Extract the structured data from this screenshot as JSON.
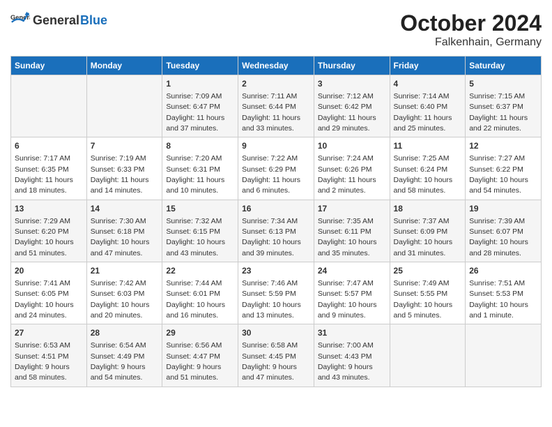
{
  "header": {
    "logo_general": "General",
    "logo_blue": "Blue",
    "month_year": "October 2024",
    "location": "Falkenhain, Germany"
  },
  "weekdays": [
    "Sunday",
    "Monday",
    "Tuesday",
    "Wednesday",
    "Thursday",
    "Friday",
    "Saturday"
  ],
  "weeks": [
    [
      {
        "day": "",
        "sunrise": "",
        "sunset": "",
        "daylight": ""
      },
      {
        "day": "",
        "sunrise": "",
        "sunset": "",
        "daylight": ""
      },
      {
        "day": "1",
        "sunrise": "Sunrise: 7:09 AM",
        "sunset": "Sunset: 6:47 PM",
        "daylight": "Daylight: 11 hours and 37 minutes."
      },
      {
        "day": "2",
        "sunrise": "Sunrise: 7:11 AM",
        "sunset": "Sunset: 6:44 PM",
        "daylight": "Daylight: 11 hours and 33 minutes."
      },
      {
        "day": "3",
        "sunrise": "Sunrise: 7:12 AM",
        "sunset": "Sunset: 6:42 PM",
        "daylight": "Daylight: 11 hours and 29 minutes."
      },
      {
        "day": "4",
        "sunrise": "Sunrise: 7:14 AM",
        "sunset": "Sunset: 6:40 PM",
        "daylight": "Daylight: 11 hours and 25 minutes."
      },
      {
        "day": "5",
        "sunrise": "Sunrise: 7:15 AM",
        "sunset": "Sunset: 6:37 PM",
        "daylight": "Daylight: 11 hours and 22 minutes."
      }
    ],
    [
      {
        "day": "6",
        "sunrise": "Sunrise: 7:17 AM",
        "sunset": "Sunset: 6:35 PM",
        "daylight": "Daylight: 11 hours and 18 minutes."
      },
      {
        "day": "7",
        "sunrise": "Sunrise: 7:19 AM",
        "sunset": "Sunset: 6:33 PM",
        "daylight": "Daylight: 11 hours and 14 minutes."
      },
      {
        "day": "8",
        "sunrise": "Sunrise: 7:20 AM",
        "sunset": "Sunset: 6:31 PM",
        "daylight": "Daylight: 11 hours and 10 minutes."
      },
      {
        "day": "9",
        "sunrise": "Sunrise: 7:22 AM",
        "sunset": "Sunset: 6:29 PM",
        "daylight": "Daylight: 11 hours and 6 minutes."
      },
      {
        "day": "10",
        "sunrise": "Sunrise: 7:24 AM",
        "sunset": "Sunset: 6:26 PM",
        "daylight": "Daylight: 11 hours and 2 minutes."
      },
      {
        "day": "11",
        "sunrise": "Sunrise: 7:25 AM",
        "sunset": "Sunset: 6:24 PM",
        "daylight": "Daylight: 10 hours and 58 minutes."
      },
      {
        "day": "12",
        "sunrise": "Sunrise: 7:27 AM",
        "sunset": "Sunset: 6:22 PM",
        "daylight": "Daylight: 10 hours and 54 minutes."
      }
    ],
    [
      {
        "day": "13",
        "sunrise": "Sunrise: 7:29 AM",
        "sunset": "Sunset: 6:20 PM",
        "daylight": "Daylight: 10 hours and 51 minutes."
      },
      {
        "day": "14",
        "sunrise": "Sunrise: 7:30 AM",
        "sunset": "Sunset: 6:18 PM",
        "daylight": "Daylight: 10 hours and 47 minutes."
      },
      {
        "day": "15",
        "sunrise": "Sunrise: 7:32 AM",
        "sunset": "Sunset: 6:15 PM",
        "daylight": "Daylight: 10 hours and 43 minutes."
      },
      {
        "day": "16",
        "sunrise": "Sunrise: 7:34 AM",
        "sunset": "Sunset: 6:13 PM",
        "daylight": "Daylight: 10 hours and 39 minutes."
      },
      {
        "day": "17",
        "sunrise": "Sunrise: 7:35 AM",
        "sunset": "Sunset: 6:11 PM",
        "daylight": "Daylight: 10 hours and 35 minutes."
      },
      {
        "day": "18",
        "sunrise": "Sunrise: 7:37 AM",
        "sunset": "Sunset: 6:09 PM",
        "daylight": "Daylight: 10 hours and 31 minutes."
      },
      {
        "day": "19",
        "sunrise": "Sunrise: 7:39 AM",
        "sunset": "Sunset: 6:07 PM",
        "daylight": "Daylight: 10 hours and 28 minutes."
      }
    ],
    [
      {
        "day": "20",
        "sunrise": "Sunrise: 7:41 AM",
        "sunset": "Sunset: 6:05 PM",
        "daylight": "Daylight: 10 hours and 24 minutes."
      },
      {
        "day": "21",
        "sunrise": "Sunrise: 7:42 AM",
        "sunset": "Sunset: 6:03 PM",
        "daylight": "Daylight: 10 hours and 20 minutes."
      },
      {
        "day": "22",
        "sunrise": "Sunrise: 7:44 AM",
        "sunset": "Sunset: 6:01 PM",
        "daylight": "Daylight: 10 hours and 16 minutes."
      },
      {
        "day": "23",
        "sunrise": "Sunrise: 7:46 AM",
        "sunset": "Sunset: 5:59 PM",
        "daylight": "Daylight: 10 hours and 13 minutes."
      },
      {
        "day": "24",
        "sunrise": "Sunrise: 7:47 AM",
        "sunset": "Sunset: 5:57 PM",
        "daylight": "Daylight: 10 hours and 9 minutes."
      },
      {
        "day": "25",
        "sunrise": "Sunrise: 7:49 AM",
        "sunset": "Sunset: 5:55 PM",
        "daylight": "Daylight: 10 hours and 5 minutes."
      },
      {
        "day": "26",
        "sunrise": "Sunrise: 7:51 AM",
        "sunset": "Sunset: 5:53 PM",
        "daylight": "Daylight: 10 hours and 1 minute."
      }
    ],
    [
      {
        "day": "27",
        "sunrise": "Sunrise: 6:53 AM",
        "sunset": "Sunset: 4:51 PM",
        "daylight": "Daylight: 9 hours and 58 minutes."
      },
      {
        "day": "28",
        "sunrise": "Sunrise: 6:54 AM",
        "sunset": "Sunset: 4:49 PM",
        "daylight": "Daylight: 9 hours and 54 minutes."
      },
      {
        "day": "29",
        "sunrise": "Sunrise: 6:56 AM",
        "sunset": "Sunset: 4:47 PM",
        "daylight": "Daylight: 9 hours and 51 minutes."
      },
      {
        "day": "30",
        "sunrise": "Sunrise: 6:58 AM",
        "sunset": "Sunset: 4:45 PM",
        "daylight": "Daylight: 9 hours and 47 minutes."
      },
      {
        "day": "31",
        "sunrise": "Sunrise: 7:00 AM",
        "sunset": "Sunset: 4:43 PM",
        "daylight": "Daylight: 9 hours and 43 minutes."
      },
      {
        "day": "",
        "sunrise": "",
        "sunset": "",
        "daylight": ""
      },
      {
        "day": "",
        "sunrise": "",
        "sunset": "",
        "daylight": ""
      }
    ]
  ]
}
